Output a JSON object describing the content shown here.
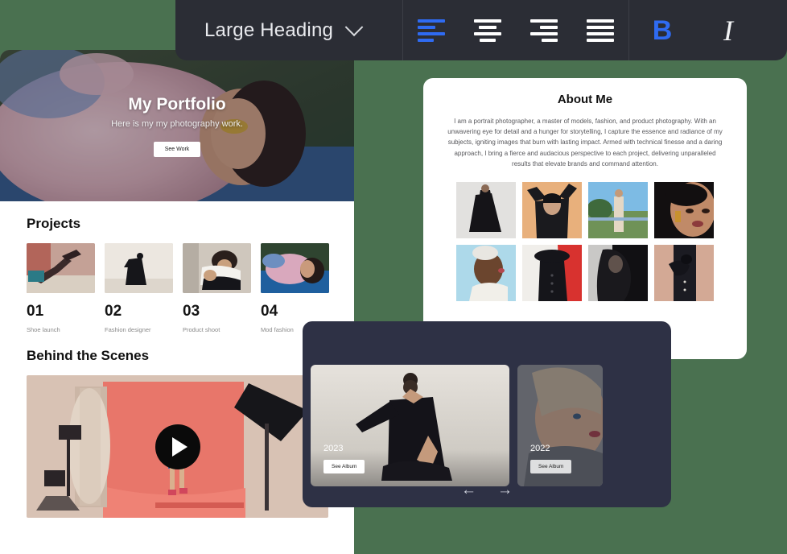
{
  "background_color": "#4a7150",
  "toolbar": {
    "background": "#2b2d35",
    "accent_color": "#2f6bf2",
    "style_select": {
      "value": "Large Heading",
      "chevron_icon": "chevron-down-icon"
    },
    "align_buttons": [
      {
        "name": "align-left",
        "icon": "align-left-icon",
        "active": true
      },
      {
        "name": "align-center",
        "icon": "align-center-icon",
        "active": false
      },
      {
        "name": "align-right",
        "icon": "align-right-icon",
        "active": false
      },
      {
        "name": "align-justify",
        "icon": "align-justify-icon",
        "active": false
      }
    ],
    "bold": {
      "glyph": "B",
      "active": true
    },
    "italic": {
      "glyph": "I",
      "active": false
    }
  },
  "portfolio": {
    "hero": {
      "title": "My Portfolio",
      "subtitle": "Here is my my photography work.",
      "cta": "See Work"
    },
    "projects_title": "Projects",
    "projects": [
      {
        "num": "01",
        "caption": "Shoe launch"
      },
      {
        "num": "02",
        "caption": "Fashion designer"
      },
      {
        "num": "03",
        "caption": "Product shoot"
      },
      {
        "num": "04",
        "caption": "Mod fashion"
      }
    ],
    "bts_title": "Behind the Scenes",
    "bts_play_icon": "play-icon"
  },
  "about": {
    "title": "About Me",
    "body": "I am a portrait photographer, a master of models, fashion, and product photography. With an unwavering eye for detail and a hunger for storytelling, I capture the essence and radiance of my subjects, igniting images that burn with lasting impact. Armed with technical finesse and a daring approach, I bring a fierce and audacious perspective to each project, delivering unparalleled results that elevate brands and command attention.",
    "gallery_count": 8
  },
  "carousel": {
    "slides": [
      {
        "year": "",
        "album_label": ""
      },
      {
        "year": "2023",
        "album_label": "See Album"
      },
      {
        "year": "2022",
        "album_label": "See Album"
      }
    ],
    "prev_icon": "arrow-left-icon",
    "prev_glyph": "←",
    "next_icon": "arrow-right-icon",
    "next_glyph": "→"
  }
}
